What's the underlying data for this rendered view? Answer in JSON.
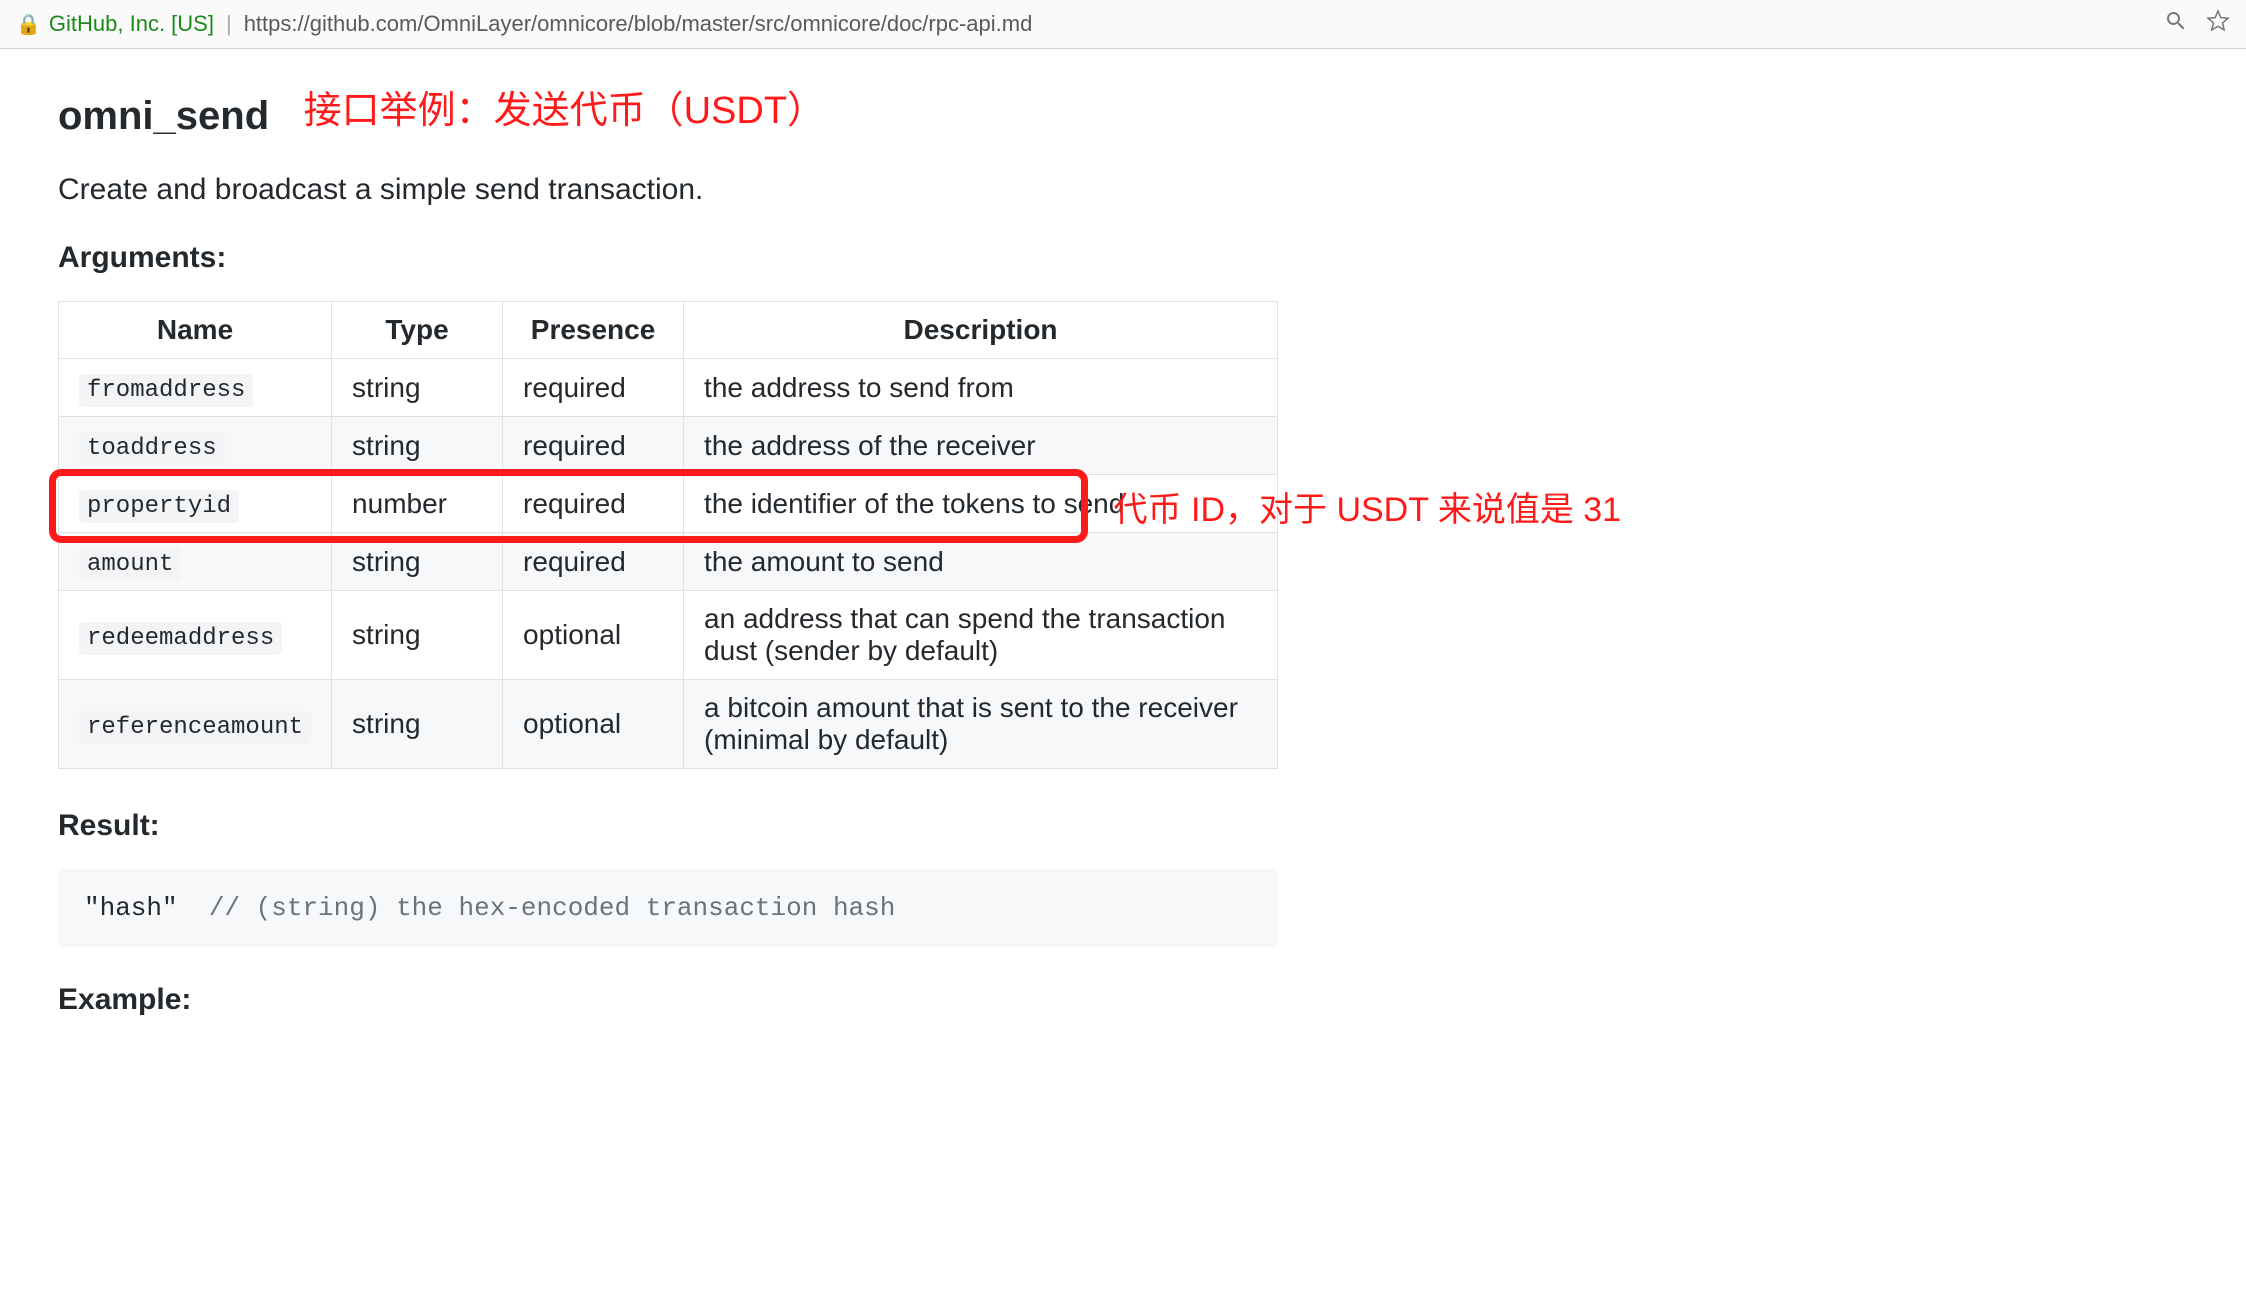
{
  "chrome": {
    "org": "GitHub, Inc. [US]",
    "url": "https://github.com/OmniLayer/omnicore/blob/master/src/omnicore/doc/rpc-api.md"
  },
  "heading": "omni_send",
  "heading_annotation": "接口举例：发送代币（USDT）",
  "description": "Create and broadcast a simple send transaction.",
  "arguments_label": "Arguments:",
  "columns": {
    "name": "Name",
    "type": "Type",
    "presence": "Presence",
    "description": "Description"
  },
  "rows": [
    {
      "name": "fromaddress",
      "type": "string",
      "presence": "required",
      "desc": "the address to send from"
    },
    {
      "name": "toaddress",
      "type": "string",
      "presence": "required",
      "desc": "the address of the receiver"
    },
    {
      "name": "propertyid",
      "type": "number",
      "presence": "required",
      "desc": "the identifier of the tokens to send"
    },
    {
      "name": "amount",
      "type": "string",
      "presence": "required",
      "desc": "the amount to send"
    },
    {
      "name": "redeemaddress",
      "type": "string",
      "presence": "optional",
      "desc": "an address that can spend the transaction dust (sender by default)"
    },
    {
      "name": "referenceamount",
      "type": "string",
      "presence": "optional",
      "desc": "a bitcoin amount that is sent to the receiver (minimal by default)"
    }
  ],
  "row_annotation": "代币 ID，对于 USDT 来说值是 31",
  "result_label": "Result:",
  "result_code_value": "\"hash\"",
  "result_code_comment": "// (string) the hex-encoded transaction hash",
  "example_label": "Example:"
}
